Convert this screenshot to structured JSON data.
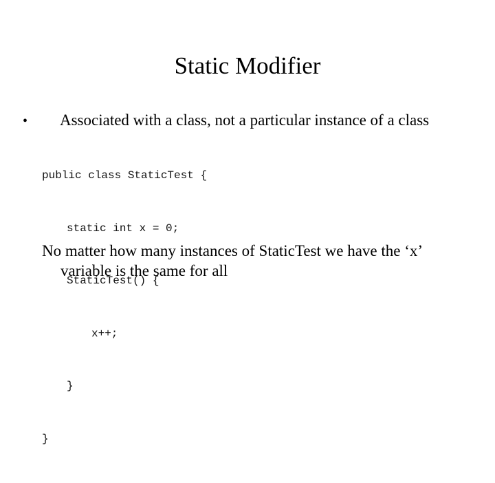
{
  "slide": {
    "title": "Static Modifier",
    "bullets": [
      {
        "icon": "•",
        "text": "Associated with a class, not a particular instance of a class"
      }
    ],
    "code": [
      "public class StaticTest {",
      "static int x = 0;",
      "StaticTest() {",
      "x++;",
      "}",
      "}"
    ],
    "note": {
      "line1": "No matter how many instances of StaticTest we have the ‘x’",
      "line2": "variable is the same for all"
    }
  }
}
